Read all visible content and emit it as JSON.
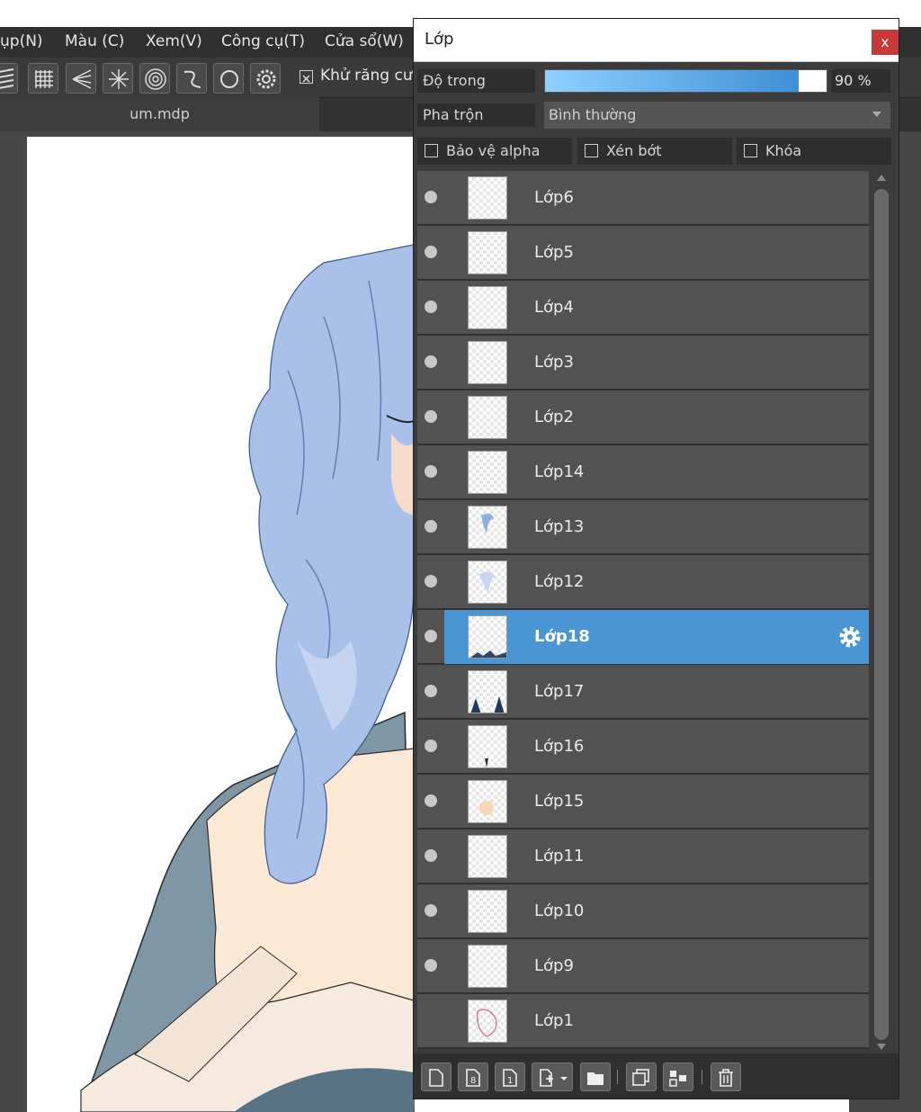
{
  "menubar": {
    "items": [
      "ụp(N)",
      "Màu (C)",
      "Xem(V)",
      "Công cụ(T)",
      "Cửa sổ(W)"
    ]
  },
  "toolbar": {
    "antialias_label": "Khử răng cưa"
  },
  "document_tab": {
    "title": "um.mdp"
  },
  "layer_panel": {
    "title": "Lớp",
    "close_label": "x",
    "opacity_label": "Độ trong",
    "opacity_value": "90 %",
    "opacity_percent": 90,
    "blend_label": "Pha trộn",
    "blend_value": "Bình thường",
    "options": {
      "protect_alpha": "Bảo vệ alpha",
      "clipping": "Xén bớt",
      "lock": "Khóa"
    },
    "accent_color": "#4a96d4",
    "layers": [
      {
        "name": "Lớp6",
        "visible": true,
        "selected": false
      },
      {
        "name": "Lớp5",
        "visible": true,
        "selected": false
      },
      {
        "name": "Lớp4",
        "visible": true,
        "selected": false
      },
      {
        "name": "Lớp3",
        "visible": true,
        "selected": false
      },
      {
        "name": "Lớp2",
        "visible": true,
        "selected": false
      },
      {
        "name": "Lớp14",
        "visible": true,
        "selected": false
      },
      {
        "name": "Lớp13",
        "visible": true,
        "selected": false
      },
      {
        "name": "Lớp12",
        "visible": true,
        "selected": false
      },
      {
        "name": "Lớp18",
        "visible": true,
        "selected": true
      },
      {
        "name": "Lớp17",
        "visible": true,
        "selected": false
      },
      {
        "name": "Lớp16",
        "visible": true,
        "selected": false
      },
      {
        "name": "Lớp15",
        "visible": true,
        "selected": false
      },
      {
        "name": "Lớp11",
        "visible": true,
        "selected": false
      },
      {
        "name": "Lớp10",
        "visible": true,
        "selected": false
      },
      {
        "name": "Lớp9",
        "visible": true,
        "selected": false
      },
      {
        "name": "Lớp1",
        "visible": false,
        "selected": false
      }
    ],
    "bottom_buttons": [
      "new-layer-icon",
      "new-8bit-layer-icon",
      "new-1bit-layer-icon",
      "add-layer-menu-icon",
      "new-folder-icon",
      "duplicate-layer-icon",
      "merge-down-icon",
      "delete-layer-icon"
    ]
  }
}
